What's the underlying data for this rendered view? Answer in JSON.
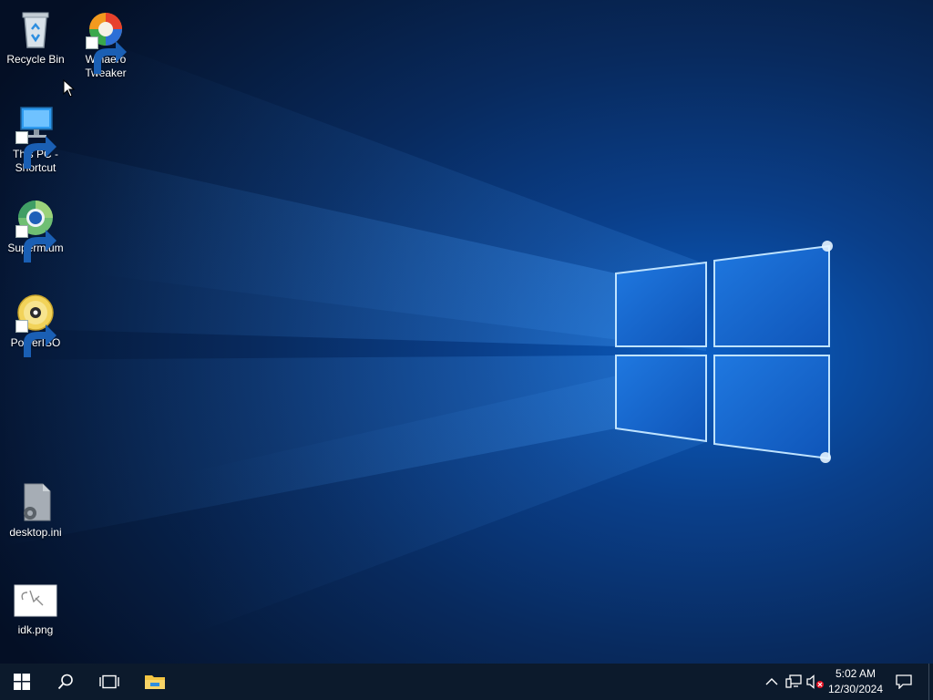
{
  "desktop": {
    "icons": [
      {
        "label": "Recycle Bin"
      },
      {
        "label": "Winaero Tweaker"
      },
      {
        "label": "This PC - Shortcut"
      },
      {
        "label": "Supermium"
      },
      {
        "label": "PowerISO"
      },
      {
        "label": "desktop.ini"
      },
      {
        "label": "idk.png"
      }
    ]
  },
  "taskbar": {
    "start_icon": "windows-logo-icon",
    "search_icon": "search-icon",
    "task_view_icon": "task-view-icon",
    "pinned": [
      {
        "icon": "file-explorer-icon"
      }
    ],
    "tray": {
      "overflow_icon": "chevron-up-icon",
      "network_icon": "network-icon",
      "volume_icon": "volume-muted-icon",
      "notifications_icon": "notifications-icon"
    },
    "clock": {
      "time": "5:02 AM",
      "date": "12/30/2024"
    }
  },
  "colors": {
    "taskbar_bg": "#0c1a2c",
    "wallpaper_accent": "#0b5ec4",
    "explorer_accent": "#f4c542",
    "folder_blue": "#2d8ee0"
  }
}
